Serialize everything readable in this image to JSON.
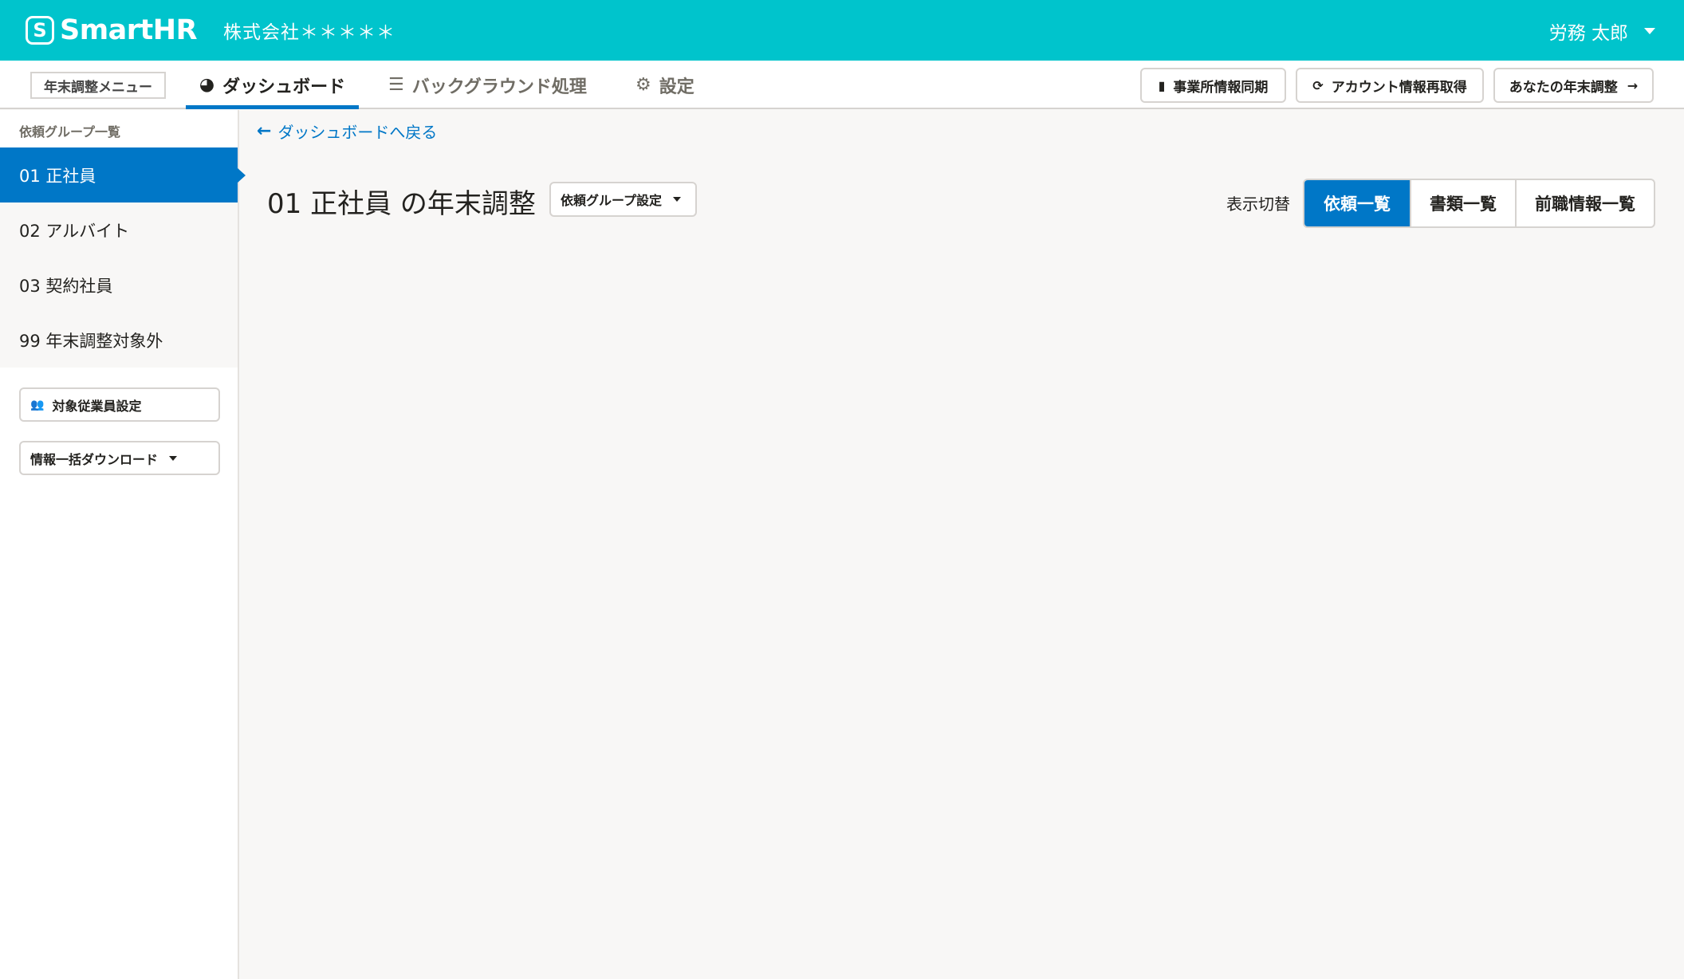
{
  "header": {
    "logo_mark": "S",
    "logo_text": "SmartHR",
    "company": "株式会社＊＊＊＊＊",
    "user_name": "労務 太郎"
  },
  "subnav": {
    "menu_label": "年末調整メニュー",
    "tabs": [
      {
        "label": "ダッシュボード",
        "icon": "dashboard-icon",
        "active": true
      },
      {
        "label": "バックグラウンド処理",
        "icon": "database-icon",
        "active": false
      },
      {
        "label": "設定",
        "icon": "gear-icon",
        "active": false
      }
    ],
    "tools": [
      {
        "label": "事業所情報同期",
        "icon": "building-icon"
      },
      {
        "label": "アカウント情報再取得",
        "icon": "refresh-icon"
      },
      {
        "label": "あなたの年末調整",
        "icon": "arrow-right-icon"
      }
    ]
  },
  "sidebar": {
    "heading": "依頼グループ一覧",
    "groups": [
      {
        "label": "01 正社員",
        "active": true
      },
      {
        "label": "02 アルバイト",
        "active": false
      },
      {
        "label": "03 契約社員",
        "active": false
      },
      {
        "label": "99 年末調整対象外",
        "active": false
      }
    ],
    "target_employee_button": "対象従業員設定",
    "download_button": "情報一括ダウンロード"
  },
  "main": {
    "back_link": "ダッシュボードへ戻る",
    "title": "01 正社員 の年末調整",
    "group_setting_button": "依頼グループ設定",
    "switch_label": "表示切替",
    "view_tabs": [
      {
        "label": "依頼一覧",
        "active": true
      },
      {
        "label": "書類一覧",
        "active": false
      },
      {
        "label": "前職情報一覧",
        "active": false
      }
    ]
  },
  "colors": {
    "brand": "#00c4cc",
    "accent": "#0077c7",
    "background": "#f8f7f6"
  }
}
